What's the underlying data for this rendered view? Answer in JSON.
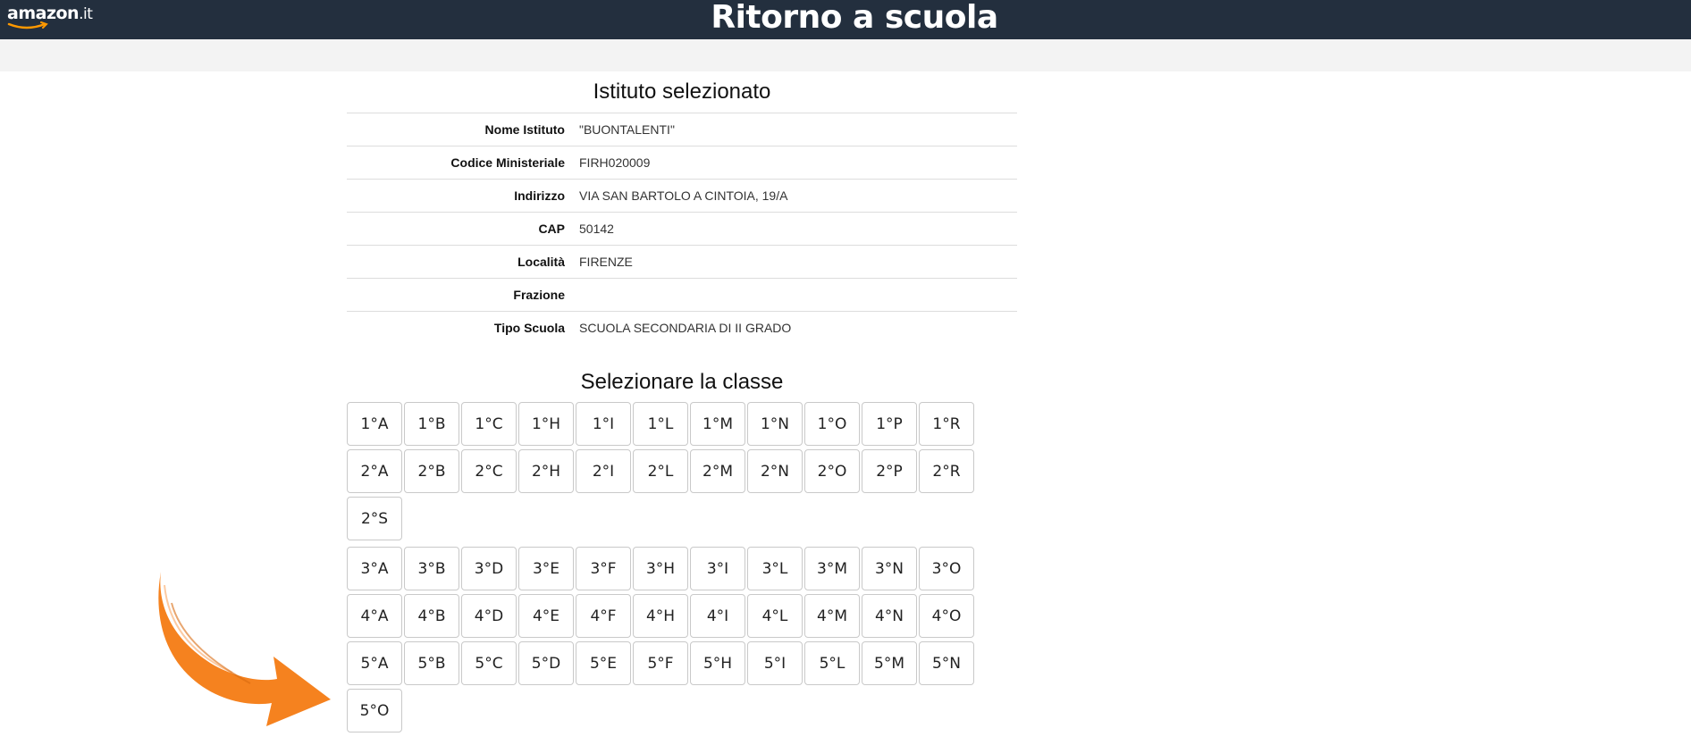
{
  "header": {
    "logo_text": "amazon",
    "logo_tld": ".it",
    "title": "Ritorno a scuola"
  },
  "school": {
    "heading": "Istituto selezionato",
    "fields": [
      {
        "label": "Nome Istituto",
        "value": "\"BUONTALENTI\""
      },
      {
        "label": "Codice Ministeriale",
        "value": "FIRH020009"
      },
      {
        "label": "Indirizzo",
        "value": "VIA SAN BARTOLO A CINTOIA, 19/A"
      },
      {
        "label": "CAP",
        "value": "50142"
      },
      {
        "label": "Località",
        "value": "FIRENZE"
      },
      {
        "label": "Frazione",
        "value": ""
      },
      {
        "label": "Tipo Scuola",
        "value": "SCUOLA SECONDARIA DI II GRADO"
      }
    ]
  },
  "classes": {
    "heading": "Selezionare la classe",
    "rows": [
      [
        "1°A",
        "1°B",
        "1°C",
        "1°H",
        "1°I",
        "1°L",
        "1°M",
        "1°N",
        "1°O",
        "1°P",
        "1°R"
      ],
      [
        "2°A",
        "2°B",
        "2°C",
        "2°H",
        "2°I",
        "2°L",
        "2°M",
        "2°N",
        "2°O",
        "2°P",
        "2°R"
      ],
      [
        "2°S"
      ],
      [
        "3°A",
        "3°B",
        "3°D",
        "3°E",
        "3°F",
        "3°H",
        "3°I",
        "3°L",
        "3°M",
        "3°N",
        "3°O"
      ],
      [
        "4°A",
        "4°B",
        "4°D",
        "4°E",
        "4°F",
        "4°H",
        "4°I",
        "4°L",
        "4°M",
        "4°N",
        "4°O"
      ],
      [
        "5°A",
        "5°B",
        "5°C",
        "5°D",
        "5°E",
        "5°F",
        "5°H",
        "5°I",
        "5°L",
        "5°M",
        "5°N"
      ],
      [
        "5°O"
      ]
    ]
  },
  "colors": {
    "header_bg": "#232f3e",
    "subbar_bg": "#f3f3f3",
    "logo_smile": "#ff9900",
    "arrow": "#f5821f"
  },
  "icons": {
    "logo_smile": "amazon-smile-icon",
    "annotation": "orange-arrow-icon"
  }
}
